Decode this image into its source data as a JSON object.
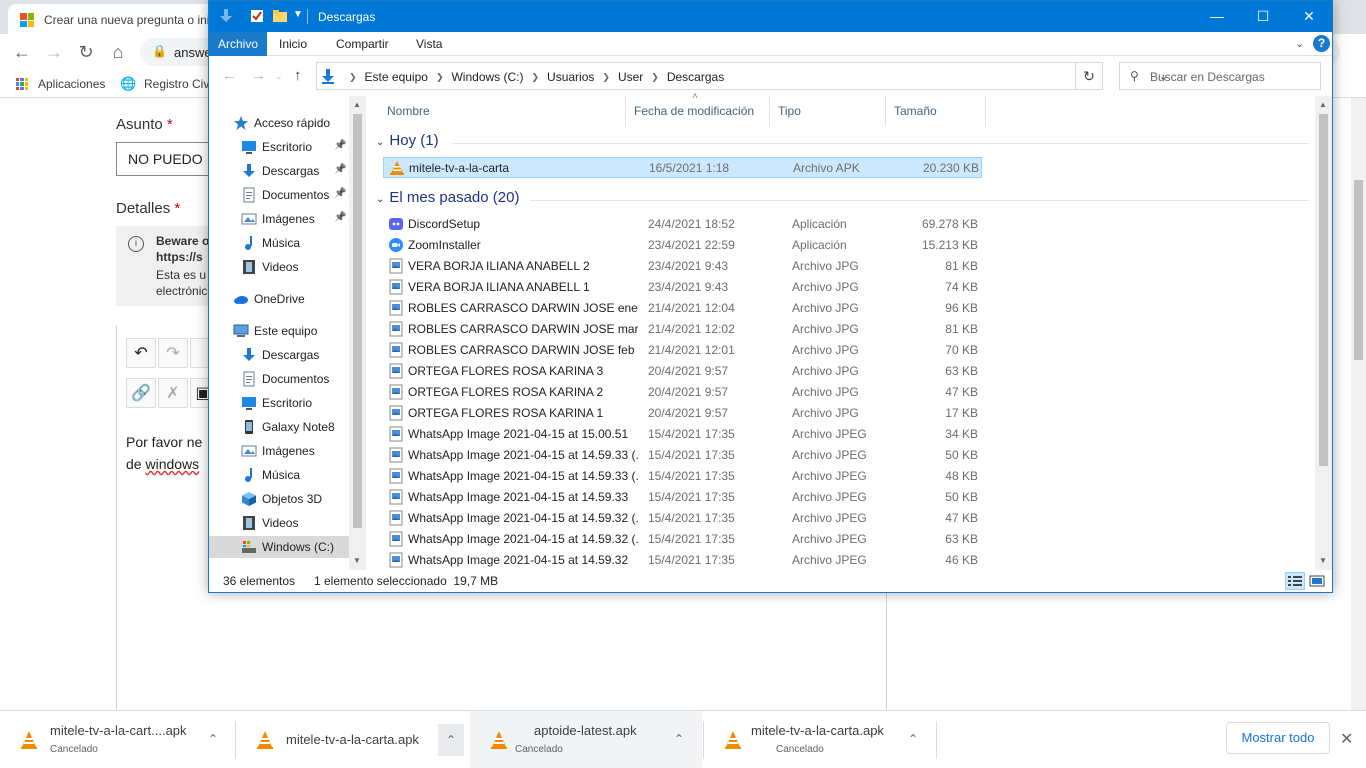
{
  "browser": {
    "tab_title": "Crear una nueva pregunta o ini",
    "url_fragment": "answe",
    "bookmarks": [
      "Aplicaciones",
      "Registro Civ"
    ]
  },
  "page": {
    "asunto_label": "Asunto",
    "asunto_value": "NO PUEDO",
    "detalles_label": "Detalles",
    "required_marker": "*",
    "beware_lines": [
      "Beware o",
      "https://s",
      "Esta es u",
      "electrónic"
    ],
    "editor_text_line1": "Por favor ne",
    "editor_text_line2_a": "de ",
    "editor_text_line2_b": "windows"
  },
  "downloads": [
    {
      "name": "mitele-tv-a-la-cart....apk",
      "status": "Cancelado"
    },
    {
      "name": "mitele-tv-a-la-carta.apk",
      "status": ""
    },
    {
      "name": "aptoide-latest.apk",
      "status": "Cancelado"
    },
    {
      "name": "mitele-tv-a-la-carta.apk",
      "status": "Cancelado"
    }
  ],
  "download_bar": {
    "show_all": "Mostrar todo"
  },
  "explorer": {
    "title": "Descargas",
    "ribbon_tabs": [
      "Archivo",
      "Inicio",
      "Compartir",
      "Vista"
    ],
    "help": "?",
    "breadcrumb": [
      "Este equipo",
      "Windows (C:)",
      "Usuarios",
      "User",
      "Descargas"
    ],
    "search_placeholder": "Buscar en Descargas",
    "nav": [
      {
        "label": "Acceso rápido",
        "icon": "star-icon",
        "indent": 0,
        "pinned": false
      },
      {
        "label": "Escritorio",
        "icon": "desktop-icon",
        "indent": 1,
        "pinned": true
      },
      {
        "label": "Descargas",
        "icon": "download-icon",
        "indent": 1,
        "pinned": true
      },
      {
        "label": "Documentos",
        "icon": "document-icon",
        "indent": 1,
        "pinned": true
      },
      {
        "label": "Imágenes",
        "icon": "pictures-icon",
        "indent": 1,
        "pinned": true
      },
      {
        "label": "Música",
        "icon": "music-icon",
        "indent": 1,
        "pinned": false
      },
      {
        "label": "Videos",
        "icon": "video-icon",
        "indent": 1,
        "pinned": false
      },
      {
        "label": "OneDrive",
        "icon": "cloud-icon",
        "indent": 0,
        "pinned": false
      },
      {
        "label": "Este equipo",
        "icon": "computer-icon",
        "indent": 0,
        "pinned": false
      },
      {
        "label": "Descargas",
        "icon": "download-icon",
        "indent": 1,
        "pinned": false
      },
      {
        "label": "Documentos",
        "icon": "document-icon",
        "indent": 1,
        "pinned": false
      },
      {
        "label": "Escritorio",
        "icon": "desktop-icon",
        "indent": 1,
        "pinned": false
      },
      {
        "label": "Galaxy Note8",
        "icon": "phone-icon",
        "indent": 1,
        "pinned": false
      },
      {
        "label": "Imágenes",
        "icon": "pictures-icon",
        "indent": 1,
        "pinned": false
      },
      {
        "label": "Música",
        "icon": "music-icon",
        "indent": 1,
        "pinned": false
      },
      {
        "label": "Objetos 3D",
        "icon": "cube-icon",
        "indent": 1,
        "pinned": false
      },
      {
        "label": "Videos",
        "icon": "video-icon",
        "indent": 1,
        "pinned": false
      },
      {
        "label": "Windows (C:)",
        "icon": "drive-icon",
        "indent": 1,
        "pinned": false,
        "selected": true
      }
    ],
    "columns": [
      "Nombre",
      "Fecha de modificación",
      "Tipo",
      "Tamaño"
    ],
    "groups": [
      {
        "label": "Hoy (1)",
        "files": [
          {
            "name": "mitele-tv-a-la-carta",
            "date": "16/5/2021 1:18",
            "type": "Archivo APK",
            "size": "20.230 KB",
            "icon": "vlc-cone-icon",
            "selected": true
          }
        ]
      },
      {
        "label": "El mes pasado (20)",
        "files": [
          {
            "name": "DiscordSetup",
            "date": "24/4/2021 18:52",
            "type": "Aplicación",
            "size": "69.278 KB",
            "icon": "discord-icon"
          },
          {
            "name": "ZoomInstaller",
            "date": "23/4/2021 22:59",
            "type": "Aplicación",
            "size": "15.213 KB",
            "icon": "zoom-icon"
          },
          {
            "name": "VERA BORJA ILIANA ANABELL 2",
            "date": "23/4/2021 9:43",
            "type": "Archivo JPG",
            "size": "81 KB",
            "icon": "image-file-icon"
          },
          {
            "name": "VERA BORJA ILIANA ANABELL 1",
            "date": "23/4/2021 9:43",
            "type": "Archivo JPG",
            "size": "74 KB",
            "icon": "image-file-icon"
          },
          {
            "name": "ROBLES CARRASCO DARWIN JOSE ene",
            "date": "21/4/2021 12:04",
            "type": "Archivo JPG",
            "size": "96 KB",
            "icon": "image-file-icon"
          },
          {
            "name": "ROBLES CARRASCO DARWIN JOSE mar",
            "date": "21/4/2021 12:02",
            "type": "Archivo JPG",
            "size": "81 KB",
            "icon": "image-file-icon"
          },
          {
            "name": "ROBLES CARRASCO DARWIN JOSE feb",
            "date": "21/4/2021 12:01",
            "type": "Archivo JPG",
            "size": "70 KB",
            "icon": "image-file-icon"
          },
          {
            "name": "ORTEGA FLORES ROSA KARINA 3",
            "date": "20/4/2021 9:57",
            "type": "Archivo JPG",
            "size": "63 KB",
            "icon": "image-file-icon"
          },
          {
            "name": "ORTEGA FLORES ROSA KARINA 2",
            "date": "20/4/2021 9:57",
            "type": "Archivo JPG",
            "size": "47 KB",
            "icon": "image-file-icon"
          },
          {
            "name": "ORTEGA FLORES ROSA KARINA 1",
            "date": "20/4/2021 9:57",
            "type": "Archivo JPG",
            "size": "17 KB",
            "icon": "image-file-icon"
          },
          {
            "name": "WhatsApp Image 2021-04-15 at 15.00.51",
            "date": "15/4/2021 17:35",
            "type": "Archivo JPEG",
            "size": "34 KB",
            "icon": "image-file-icon"
          },
          {
            "name": "WhatsApp Image 2021-04-15 at 14.59.33 (...",
            "date": "15/4/2021 17:35",
            "type": "Archivo JPEG",
            "size": "50 KB",
            "icon": "image-file-icon"
          },
          {
            "name": "WhatsApp Image 2021-04-15 at 14.59.33 (...",
            "date": "15/4/2021 17:35",
            "type": "Archivo JPEG",
            "size": "48 KB",
            "icon": "image-file-icon"
          },
          {
            "name": "WhatsApp Image 2021-04-15 at 14.59.33",
            "date": "15/4/2021 17:35",
            "type": "Archivo JPEG",
            "size": "50 KB",
            "icon": "image-file-icon"
          },
          {
            "name": "WhatsApp Image 2021-04-15 at 14.59.32 (...",
            "date": "15/4/2021 17:35",
            "type": "Archivo JPEG",
            "size": "47 KB",
            "icon": "image-file-icon"
          },
          {
            "name": "WhatsApp Image 2021-04-15 at 14.59.32 (...",
            "date": "15/4/2021 17:35",
            "type": "Archivo JPEG",
            "size": "63 KB",
            "icon": "image-file-icon"
          },
          {
            "name": "WhatsApp Image 2021-04-15 at 14.59.32",
            "date": "15/4/2021 17:35",
            "type": "Archivo JPEG",
            "size": "46 KB",
            "icon": "image-file-icon"
          }
        ]
      }
    ],
    "status": {
      "count": "36 elementos",
      "selection": "1 elemento seleccionado  19,7 MB"
    }
  },
  "colors": {
    "accent": "#0078d7",
    "selected_row": "#cce8ff",
    "group_header": "#1e3287",
    "vlc_orange": "#f08a00"
  }
}
